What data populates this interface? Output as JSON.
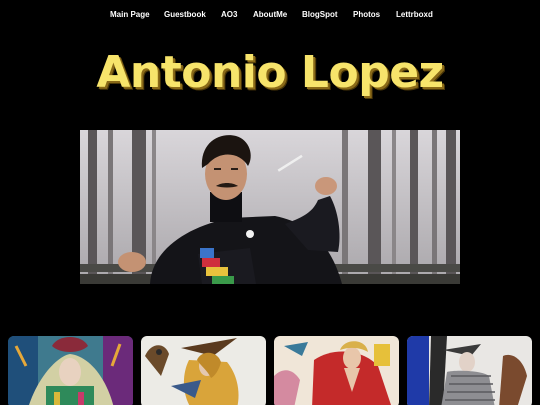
{
  "nav": {
    "items": [
      {
        "label": "Main Page"
      },
      {
        "label": "Guestbook"
      },
      {
        "label": "AO3"
      },
      {
        "label": "AboutMe"
      },
      {
        "label": "BlogSpot"
      },
      {
        "label": "Photos"
      },
      {
        "label": "Lettrboxd"
      }
    ]
  },
  "header": {
    "title": "Antonio Lopez"
  },
  "colors": {
    "background": "#000000",
    "title_fill": "#f7e46b",
    "title_shadow": "#8a6a18",
    "nav_text": "#ffffff"
  },
  "hero": {
    "image": "portrait-photo"
  },
  "gallery": {
    "items": [
      {
        "image": "fashion-illustration-1"
      },
      {
        "image": "fashion-illustration-2"
      },
      {
        "image": "fashion-illustration-3"
      },
      {
        "image": "fashion-illustration-4"
      }
    ]
  }
}
